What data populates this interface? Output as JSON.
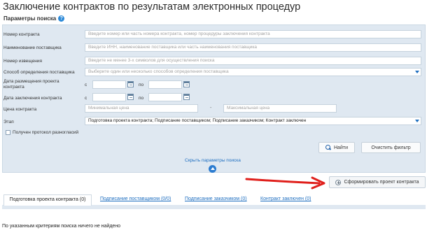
{
  "page": {
    "title": "Заключение контрактов по результатам электронных процедур",
    "subtitle": "Параметры поиска",
    "help_icon": "?"
  },
  "form": {
    "contract_number": {
      "label": "Номер контракта",
      "placeholder": "Введите номер или часть номера контракта, номер процедуры заключения контракта"
    },
    "supplier_name": {
      "label": "Наименование поставщика",
      "placeholder": "Введите ИНН, наименование поставщика или часть наименования поставщика"
    },
    "notice_number": {
      "label": "Номер извещения",
      "placeholder": "Введите не менее 3-х символов для осуществления поиска"
    },
    "supplier_method": {
      "label": "Способ определения поставщика",
      "placeholder": "Выберите один или несколько способов определения поставщика"
    },
    "draft_date": {
      "label": "Дата размещения проекта контракта",
      "from": "с",
      "to": "по"
    },
    "conclusion_date": {
      "label": "Дата заключения контракта",
      "from": "с",
      "to": "по"
    },
    "price": {
      "label": "Цена контракта",
      "min_placeholder": "Минимальная цена",
      "separator": "-",
      "max_placeholder": "Максимальная цена"
    },
    "stage": {
      "label": "Этап",
      "value": "Подготовка проекта контракта; Подписание поставщиком; Подписание заказчиком; Контракт заключен"
    },
    "disagreement_checkbox": {
      "label": "Получен протокол разногласий",
      "checked": false
    },
    "search_button": "Найти",
    "clear_button": "Очистить фильтр",
    "hide_params_link": "Скрыть параметры поиска"
  },
  "actions": {
    "create_draft_button": "Сформировать проект контракта"
  },
  "tabs": [
    {
      "label": "Подготовка проекта контракта (0)",
      "active": true
    },
    {
      "label": "Подписание поставщиком (0/0)",
      "active": false
    },
    {
      "label": "Подписание заказчиком (0)",
      "active": false
    },
    {
      "label": "Контракт заключен (0)",
      "active": false
    }
  ],
  "results": {
    "empty_message": "По указанным критериям поиска ничего не найдено"
  },
  "colors": {
    "panel_bg": "#dfe8f1",
    "link": "#1f6fc0",
    "annotation_arrow": "#e0201c"
  }
}
